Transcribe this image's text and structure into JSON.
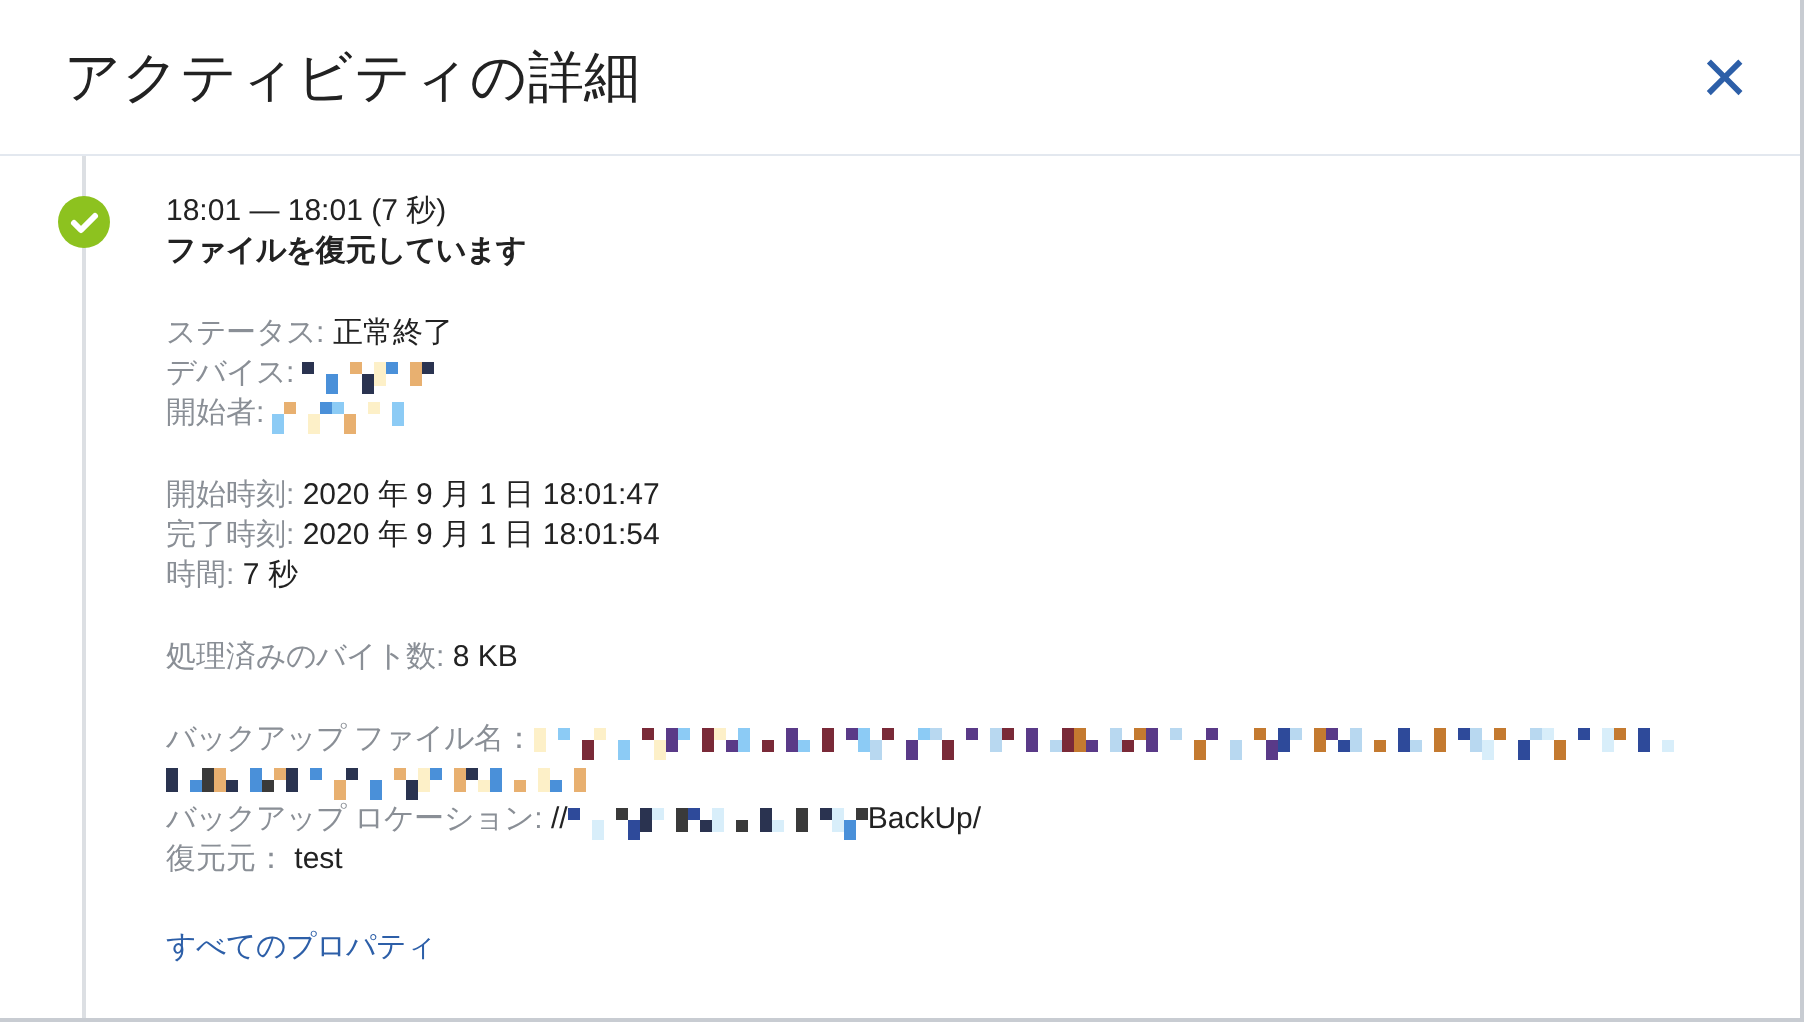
{
  "dialog": {
    "title": "アクティビティの詳細",
    "close": "×"
  },
  "activity": {
    "succeeded": true,
    "time": "18:01 — 18:01 (7 秒)",
    "title": "ファイルを復元しています",
    "groups": [
      [
        {
          "label": "ステータス: ",
          "value": "正常終了",
          "kind": "text"
        },
        {
          "label": "デバイス: ",
          "kind": "redacted_short"
        },
        {
          "label": "開始者: ",
          "kind": "redacted_short"
        }
      ],
      [
        {
          "label": "開始時刻: ",
          "value": "2020 年 9 月 1 日 18:01:47",
          "kind": "text"
        },
        {
          "label": "完了時刻: ",
          "value": "2020 年 9 月 1 日 18:01:54",
          "kind": "text"
        },
        {
          "label": "時間: ",
          "value": "7 秒",
          "kind": "text"
        }
      ],
      [
        {
          "label": "処理済みのバイト数: ",
          "value": "8 KB",
          "kind": "text"
        }
      ],
      [
        {
          "label": "バックアップ ファイル名：",
          "kind": "redacted_long"
        },
        {
          "label": "バックアップ ロケーション: ",
          "value": "//",
          "value_after": "BackUp/",
          "kind": "partly_redacted"
        },
        {
          "label": "復元元： ",
          "value": "test",
          "kind": "text"
        }
      ]
    ],
    "link": "すべてのプロパティ"
  }
}
